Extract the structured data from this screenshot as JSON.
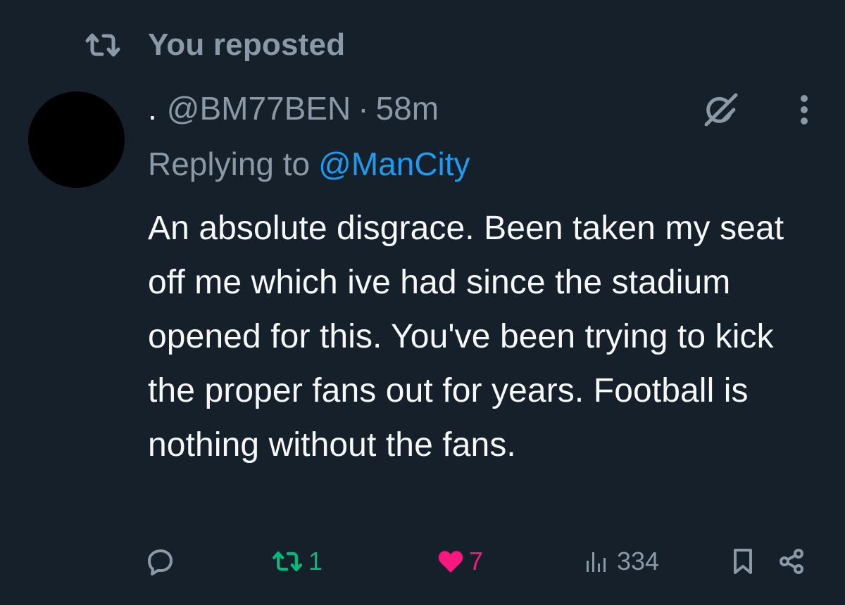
{
  "repost_banner": {
    "label": "You reposted",
    "icon": "repost-icon"
  },
  "tweet": {
    "avatar_color": "#000000",
    "display_name": ".",
    "handle": "@BM77BEN",
    "separator": "·",
    "time": "58m",
    "replying_prefix": "Replying to",
    "replying_to": "@ManCity",
    "body": "An absolute disgrace. Been taken my seat off me which ive had since the stadium opened for this. You've been trying to kick the proper fans out for years. Football is nothing without the fans.",
    "header_icons": [
      "grok-icon",
      "more-icon"
    ]
  },
  "actions": {
    "reply_icon": "reply-icon",
    "repost_count": "1",
    "like_count": "7",
    "views_count": "334",
    "bookmark_icon": "bookmark-icon",
    "share_icon": "share-icon"
  },
  "colors": {
    "background": "#15202b",
    "text_primary": "#f7f9f9",
    "text_secondary": "#8b98a5",
    "link": "#1d9bf0",
    "repost_active": "#00ba7c",
    "like_active": "#f91880"
  }
}
